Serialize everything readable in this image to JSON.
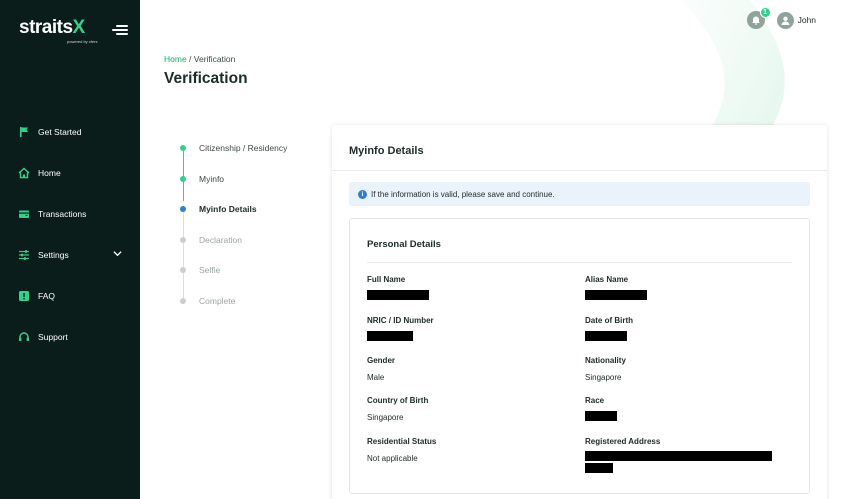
{
  "brand": {
    "name": "straits",
    "accent": "X",
    "tagline": "powered by xfers"
  },
  "colors": {
    "sidebar_bg": "#0b1d1a",
    "accent": "#2ed38a",
    "active_step": "#2f7fd1",
    "pending_step": "#c9d0ce"
  },
  "nav": {
    "items": [
      {
        "label": "Get Started",
        "icon": "flag-icon"
      },
      {
        "label": "Home",
        "icon": "home-icon"
      },
      {
        "label": "Transactions",
        "icon": "wallet-icon"
      },
      {
        "label": "Settings",
        "icon": "sliders-icon"
      },
      {
        "label": "FAQ",
        "icon": "faq-icon"
      },
      {
        "label": "Support",
        "icon": "headset-icon"
      }
    ]
  },
  "topbar": {
    "notification_count": "1",
    "user_name": "John"
  },
  "breadcrumb": {
    "home": "Home",
    "separator": " / ",
    "current": "Verification"
  },
  "page": {
    "title": "Verification"
  },
  "steps": [
    {
      "label": "Citizenship / Residency",
      "state": "done"
    },
    {
      "label": "Myinfo",
      "state": "done"
    },
    {
      "label": "Myinfo Details",
      "state": "active"
    },
    {
      "label": "Declaration",
      "state": "pending"
    },
    {
      "label": "Selfie",
      "state": "pending"
    },
    {
      "label": "Complete",
      "state": "pending"
    }
  ],
  "card": {
    "title": "Myinfo Details",
    "info": "If the information is valid, please save and continue."
  },
  "personal": {
    "title": "Personal Details",
    "fields": {
      "full_name": {
        "label": "Full Name"
      },
      "alias_name": {
        "label": "Alias Name"
      },
      "nric": {
        "label": "NRIC / ID Number"
      },
      "dob": {
        "label": "Date of Birth"
      },
      "gender": {
        "label": "Gender",
        "value": "Male"
      },
      "nationality": {
        "label": "Nationality",
        "value": "Singapore"
      },
      "country_of_birth": {
        "label": "Country of Birth",
        "value": "Singapore"
      },
      "race": {
        "label": "Race"
      },
      "residential_status": {
        "label": "Residential Status",
        "value": "Not applicable"
      },
      "registered_address": {
        "label": "Registered Address"
      }
    }
  }
}
